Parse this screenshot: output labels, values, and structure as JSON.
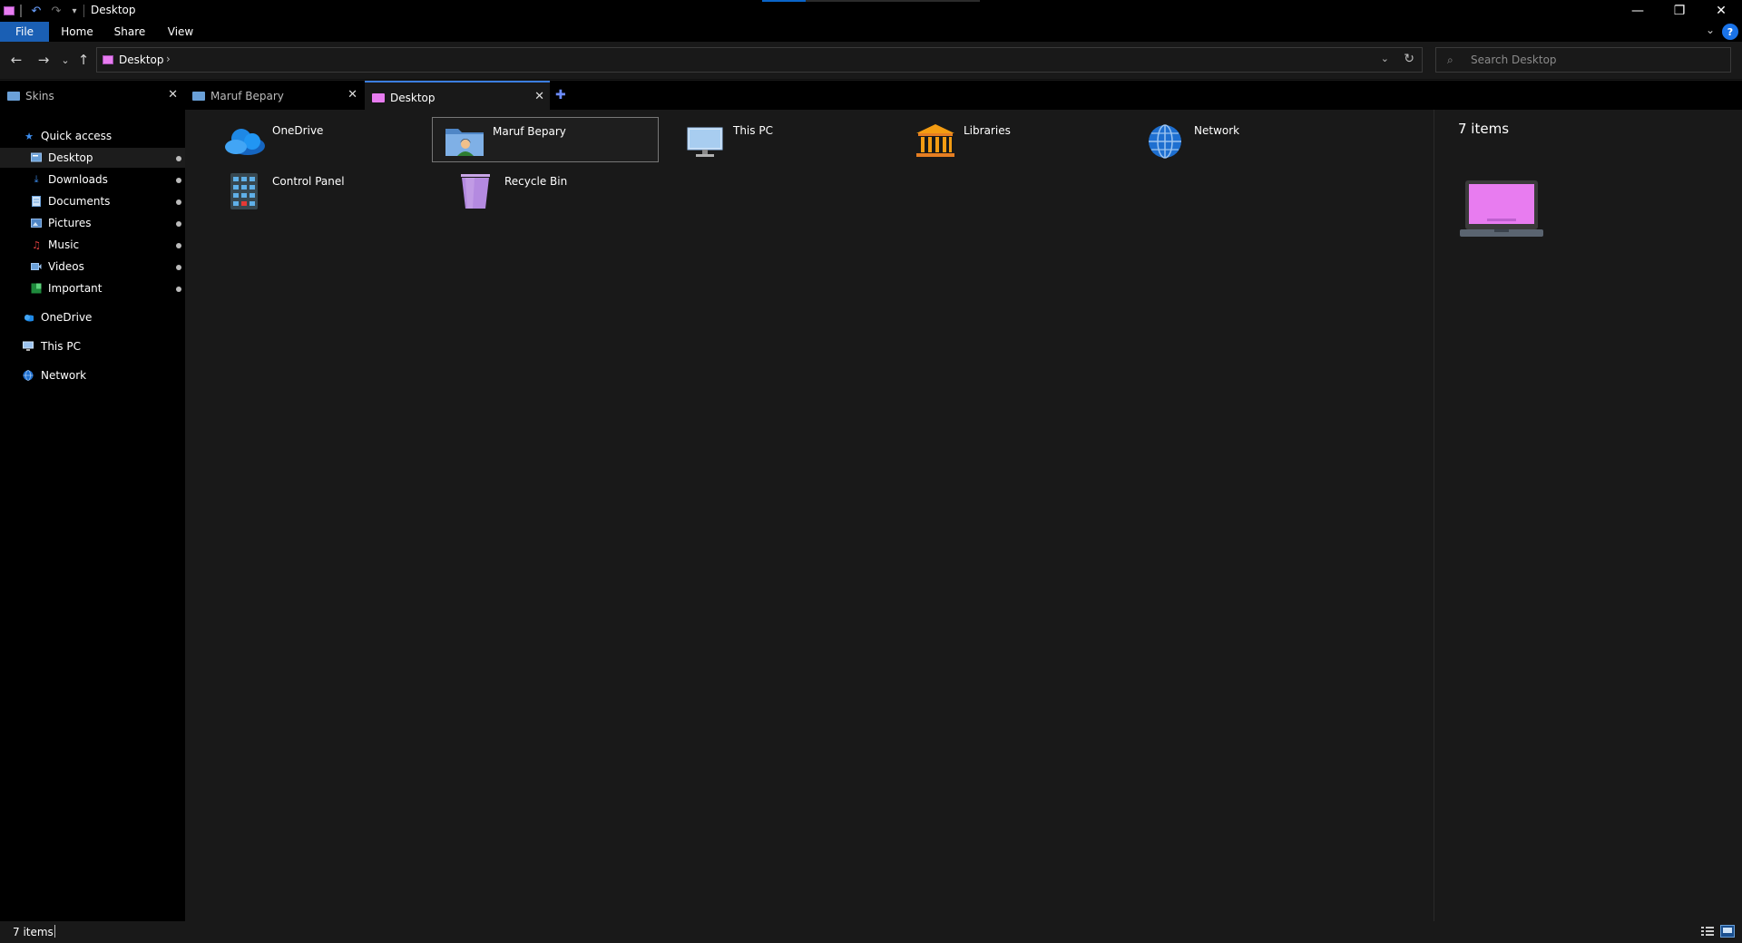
{
  "window": {
    "title": "Desktop",
    "controls": {
      "minimize": "—",
      "restore": "❐",
      "close": "✕"
    }
  },
  "quick_access_toolbar": {
    "undo": "↶",
    "redo": "↷",
    "customize": "▾"
  },
  "ribbon": {
    "tabs": [
      "File",
      "Home",
      "Share",
      "View"
    ],
    "collapse": "⌄",
    "help": "?"
  },
  "address_bar": {
    "back": "←",
    "forward": "→",
    "recent": "⌄",
    "up": "↑",
    "path": "Desktop",
    "separator": "›",
    "dropdown": "⌄",
    "refresh": "↻"
  },
  "search": {
    "placeholder": "Search Desktop",
    "icon": "search-icon"
  },
  "tabs": [
    {
      "label": "Skins",
      "close": "✕",
      "color": "#6aa0d8",
      "active": false
    },
    {
      "label": "Maruf Bepary",
      "close": "✕",
      "color": "#6aa0d8",
      "active": false
    },
    {
      "label": "Desktop",
      "close": "✕",
      "color": "#e87cf0",
      "active": true
    }
  ],
  "new_tab": "✚",
  "nav_pane": {
    "quick_access": {
      "label": "Quick access",
      "items": [
        {
          "label": "Desktop",
          "icon": "desktop-icon",
          "pinned": true
        },
        {
          "label": "Downloads",
          "icon": "download-icon",
          "pinned": true
        },
        {
          "label": "Documents",
          "icon": "documents-icon",
          "pinned": true
        },
        {
          "label": "Pictures",
          "icon": "pictures-icon",
          "pinned": true
        },
        {
          "label": "Music",
          "icon": "music-icon",
          "pinned": true
        },
        {
          "label": "Videos",
          "icon": "videos-icon",
          "pinned": true
        },
        {
          "label": "Important",
          "icon": "important-folder-icon",
          "pinned": true
        }
      ]
    },
    "roots": [
      {
        "label": "OneDrive",
        "icon": "cloud-icon"
      },
      {
        "label": "This PC",
        "icon": "computer-icon"
      },
      {
        "label": "Network",
        "icon": "network-icon"
      }
    ]
  },
  "content": {
    "items": [
      {
        "label": "OneDrive",
        "icon": "onedrive-icon"
      },
      {
        "label": "Maruf Bepary",
        "icon": "user-folder-icon",
        "selected": true
      },
      {
        "label": "This PC",
        "icon": "this-pc-icon"
      },
      {
        "label": "Libraries",
        "icon": "libraries-icon"
      },
      {
        "label": "Network",
        "icon": "network-globe-icon"
      },
      {
        "label": "Control Panel",
        "icon": "control-panel-icon"
      },
      {
        "label": "Recycle Bin",
        "icon": "recycle-bin-icon"
      }
    ]
  },
  "preview": {
    "count": "7 items",
    "icon": "laptop-icon"
  },
  "status_bar": {
    "count": "7 items"
  },
  "colors": {
    "accent": "#1a5fb4",
    "desktop_pink": "#e87cf0",
    "folder_blue": "#6aa0d8",
    "background": "#191919"
  }
}
